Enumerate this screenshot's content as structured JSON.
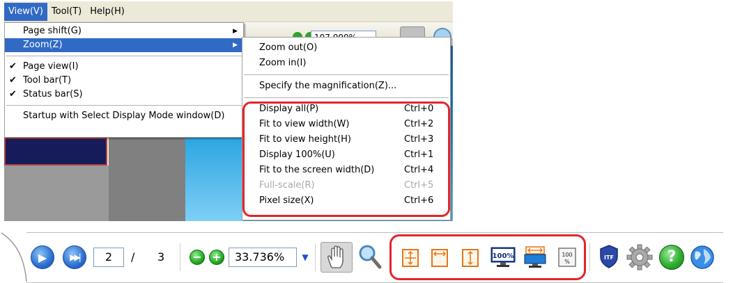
{
  "menubar": {
    "items": [
      {
        "label": "View(V)"
      },
      {
        "label": "Tool(T)"
      },
      {
        "label": "Help(H)"
      }
    ]
  },
  "background": {
    "zoom_field_value": "107.000%"
  },
  "view_menu": {
    "items": [
      {
        "label": "Page shift(G)",
        "submenu": true
      },
      {
        "label": "Zoom(Z)",
        "submenu": true,
        "highlighted": true
      },
      {
        "label": "Page view(I)",
        "checked": true
      },
      {
        "label": "Tool bar(T)",
        "checked": true
      },
      {
        "label": "Status bar(S)",
        "checked": true
      },
      {
        "label": "Startup with Select Display Mode window(D)"
      }
    ]
  },
  "zoom_menu": {
    "items": [
      {
        "label": "Zoom out(O)"
      },
      {
        "label": "Zoom in(I)"
      },
      {
        "label": "Specify the magnification(Z)..."
      },
      {
        "label": "Display all(P)",
        "shortcut": "Ctrl+0"
      },
      {
        "label": "Fit to view width(W)",
        "shortcut": "Ctrl+2"
      },
      {
        "label": "Fit to view height(H)",
        "shortcut": "Ctrl+3"
      },
      {
        "label": "Display 100%(U)",
        "shortcut": "Ctrl+1"
      },
      {
        "label": "Fit to the screen width(D)",
        "shortcut": "Ctrl+4"
      },
      {
        "label": "Full-scale(R)",
        "shortcut": "Ctrl+5",
        "disabled": true
      },
      {
        "label": "Pixel size(X)",
        "shortcut": "Ctrl+6"
      }
    ]
  },
  "toolbar": {
    "current_page": "2",
    "page_separator": "/",
    "total_pages": "3",
    "zoom_value": "33.736%",
    "icon_100_label": "100%",
    "icon_100_small_top": "100",
    "icon_100_small_bottom": "%",
    "info_label": "ITF"
  },
  "colors": {
    "menu_highlight": "#316ac5",
    "callout_red": "#e3242b",
    "orange_icon": "#e2761b"
  }
}
